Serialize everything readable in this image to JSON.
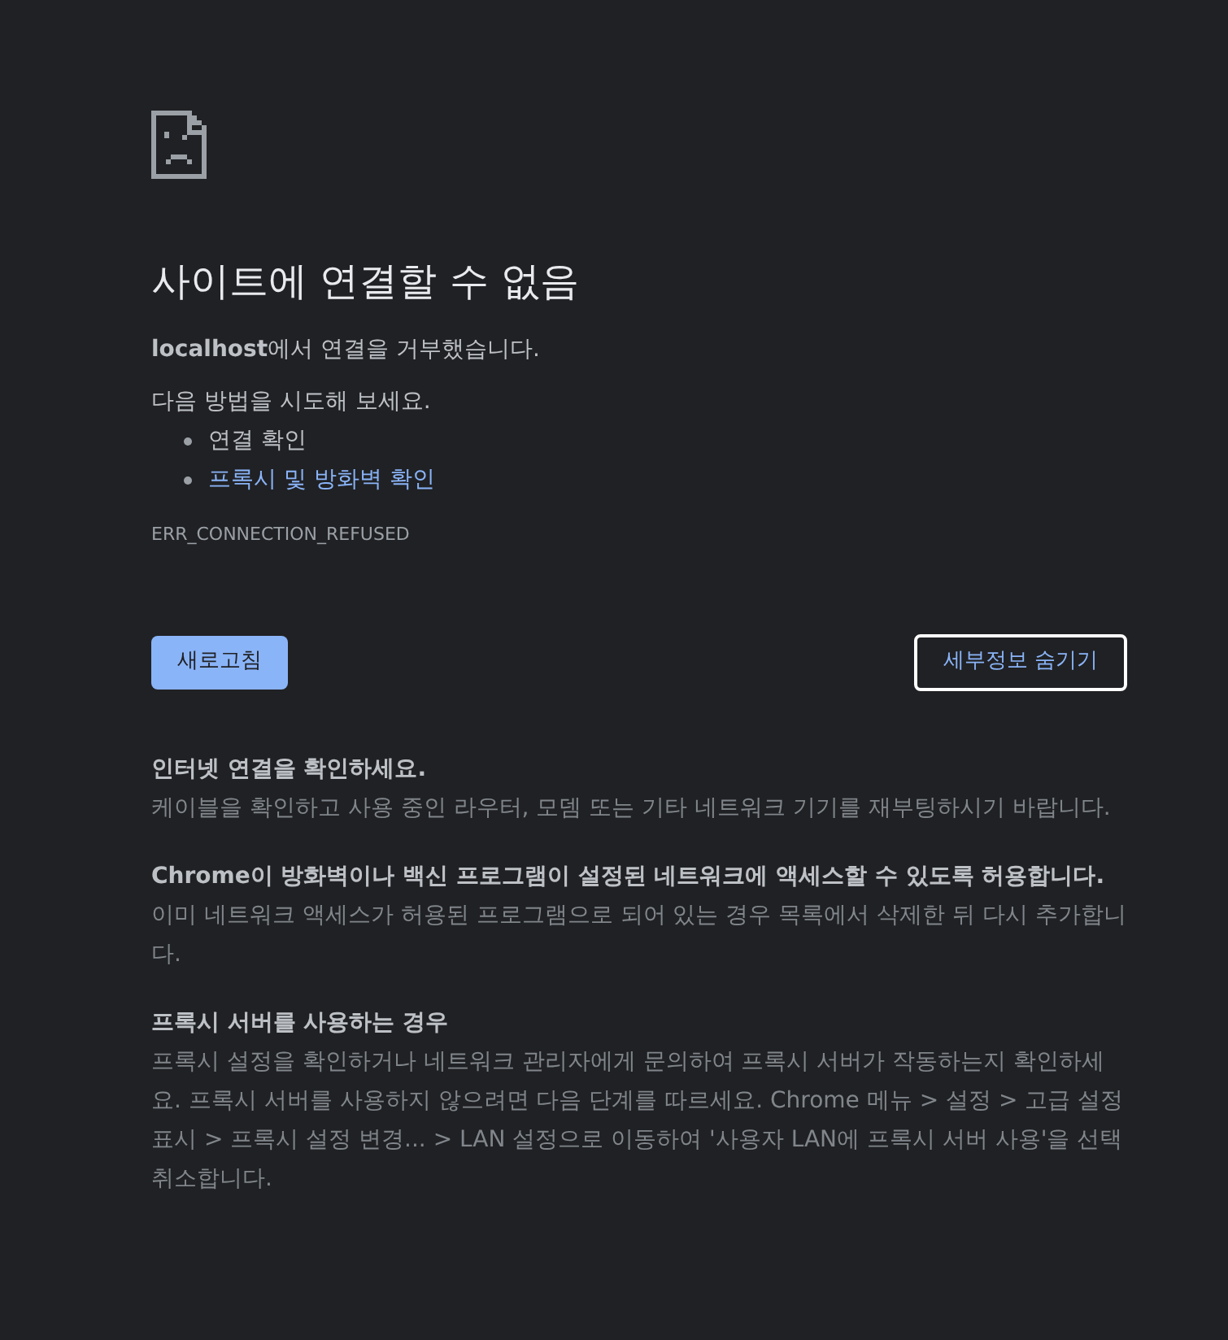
{
  "title": "사이트에 연결할 수 없음",
  "message": "**localhost**에서 연결을 거부했습니다.",
  "suggestions_intro": "다음 방법을 시도해 보세요.",
  "suggestions": [
    {
      "text": "연결 확인",
      "kind": "plain"
    },
    {
      "text": "프록시 및 방화벽 확인",
      "kind": "link"
    }
  ],
  "error_code": "ERR_CONNECTION_REFUSED",
  "reload_button": "새로고침",
  "details_button": "세부정보 숨기기",
  "details": [
    {
      "heading": "인터넷 연결을 확인하세요.",
      "body": "케이블을 확인하고 사용 중인 라우터, 모뎀 또는 기타 네트워크 기기를 재부팅하시기 바랍니다."
    },
    {
      "heading": "Chrome이 방화벽이나 백신 프로그램이 설정된 네트워크에 액세스할 수 있도록 허용합니다.",
      "body": "이미 네트워크 액세스가 허용된 프로그램으로 되어 있는 경우 목록에서 삭제한 뒤 다시 추가합니다."
    },
    {
      "heading": "프록시 서버를 사용하는 경우",
      "body": "프록시 설정을 확인하거나 네트워크 관리자에게 문의하여 프록시 서버가 작동하는지 확인하세요. 프록시 서버를 사용하지 않으려면 다음 단계를 따르세요. Chrome 메뉴 > 설정 > 고급 설정 표시 > 프록시 설정 변경... > LAN 설정으로 이동하여 '사용자 LAN에 프록시 서버 사용'을 선택 취소합니다."
    }
  ]
}
